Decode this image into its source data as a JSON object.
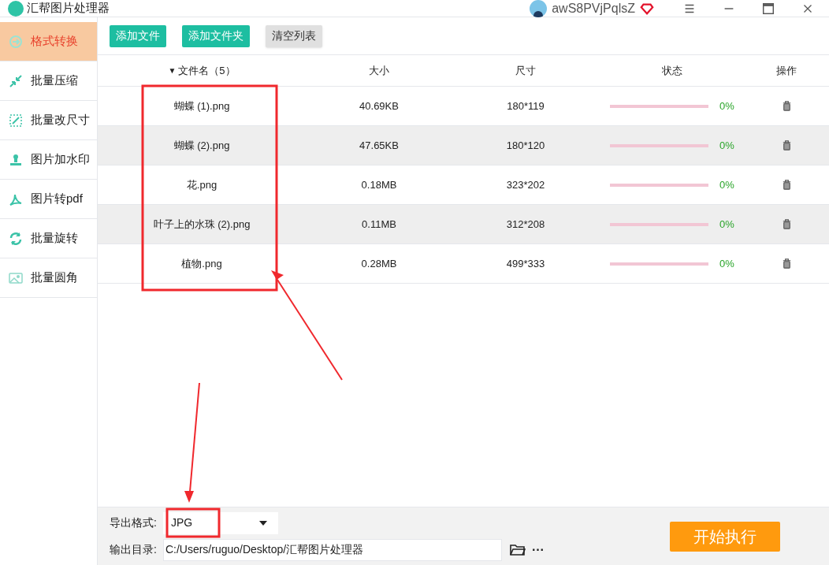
{
  "window": {
    "title": "汇帮图片处理器",
    "username": "awS8PVjPqlsZ"
  },
  "sidebar": {
    "items": [
      {
        "label": "格式转换",
        "selected": true
      },
      {
        "label": "批量压缩",
        "selected": false
      },
      {
        "label": "批量改尺寸",
        "selected": false
      },
      {
        "label": "图片加水印",
        "selected": false
      },
      {
        "label": "图片转pdf",
        "selected": false
      },
      {
        "label": "批量旋转",
        "selected": false
      },
      {
        "label": "批量圆角",
        "selected": false
      }
    ]
  },
  "toolbar": {
    "buttons": [
      {
        "label": "添加文件",
        "kind": "primary"
      },
      {
        "label": "添加文件夹",
        "kind": "primary"
      },
      {
        "label": "清空列表",
        "kind": "secondary"
      }
    ]
  },
  "table": {
    "sort_indicator": "▼",
    "columns": [
      "文件名（5）",
      "大小",
      "尺寸",
      "状态",
      "操作"
    ],
    "rows": [
      {
        "name": "蝴蝶 (1).png",
        "size": "40.69KB",
        "dimensions": "180*119",
        "level": 0,
        "percent": "0%"
      },
      {
        "name": "蝴蝶 (2).png",
        "size": "47.65KB",
        "dimensions": "180*120",
        "level": 0,
        "percent": "0%"
      },
      {
        "name": "花.png",
        "size": "0.18MB",
        "dimensions": "323*202",
        "level": 0,
        "percent": "0%"
      },
      {
        "name": "叶子上的水珠 (2).png",
        "size": "0.11MB",
        "dimensions": "312*208",
        "level": 0,
        "percent": "0%"
      },
      {
        "name": "植物.png",
        "size": "0.28MB",
        "dimensions": "499*333",
        "level": 0,
        "percent": "0%"
      }
    ]
  },
  "bottom": {
    "format_label": "导出格式:",
    "format_value": "JPG",
    "output_label": "输出目录:",
    "output_value": "C:/Users/ruguo/Desktop/汇帮图片处理器",
    "more": "···",
    "start_button": "开始执行"
  }
}
